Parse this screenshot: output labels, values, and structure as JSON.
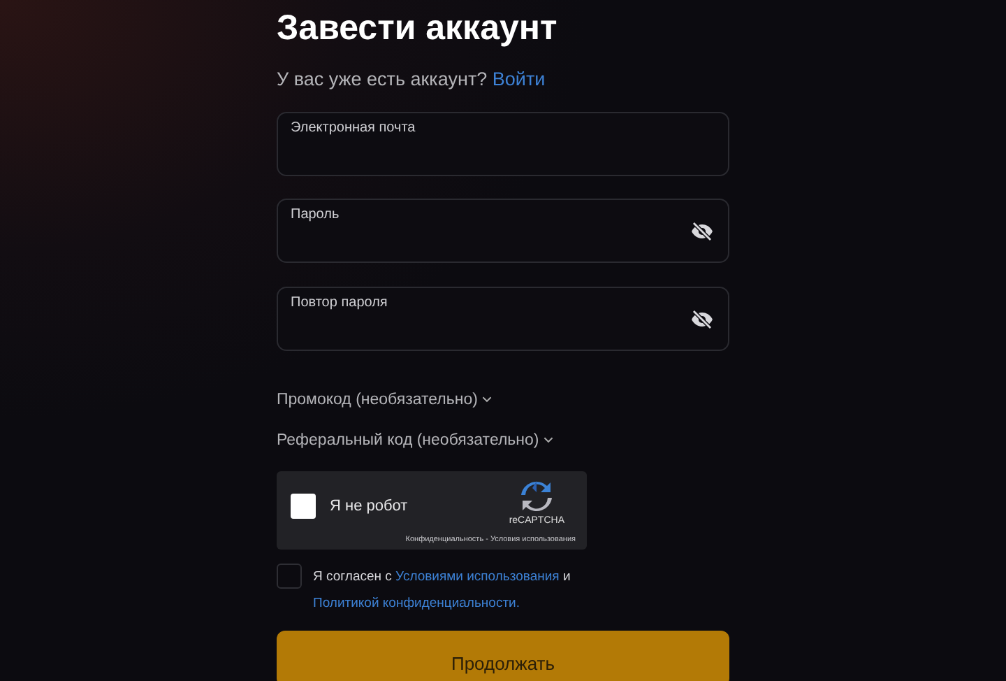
{
  "title": "Завести аккаунт",
  "login_prompt": {
    "text": "У вас уже есть аккаунт?",
    "link": "Войти"
  },
  "fields": [
    {
      "label": "Электронная почта",
      "visibility_toggle": false
    },
    {
      "label": "Пароль",
      "visibility_toggle": true
    },
    {
      "label": "Повтор пароля",
      "visibility_toggle": true
    }
  ],
  "optional_sections": [
    {
      "label": "Промокод (необязательно)",
      "expanded": false
    },
    {
      "label": "Реферальный код (необязательно)",
      "expanded": false
    }
  ],
  "captcha": {
    "label": "Я не робот",
    "checked": false,
    "brand": "reCAPTCHA",
    "footer": "Конфиденциальность - Условия использования"
  },
  "terms": {
    "checked": false,
    "text_before": "Я согласен с",
    "link_terms": "Условиями использования",
    "text_middle": "и",
    "link_privacy": "Политикой конфиденциальности."
  },
  "submit": "Продолжать"
}
